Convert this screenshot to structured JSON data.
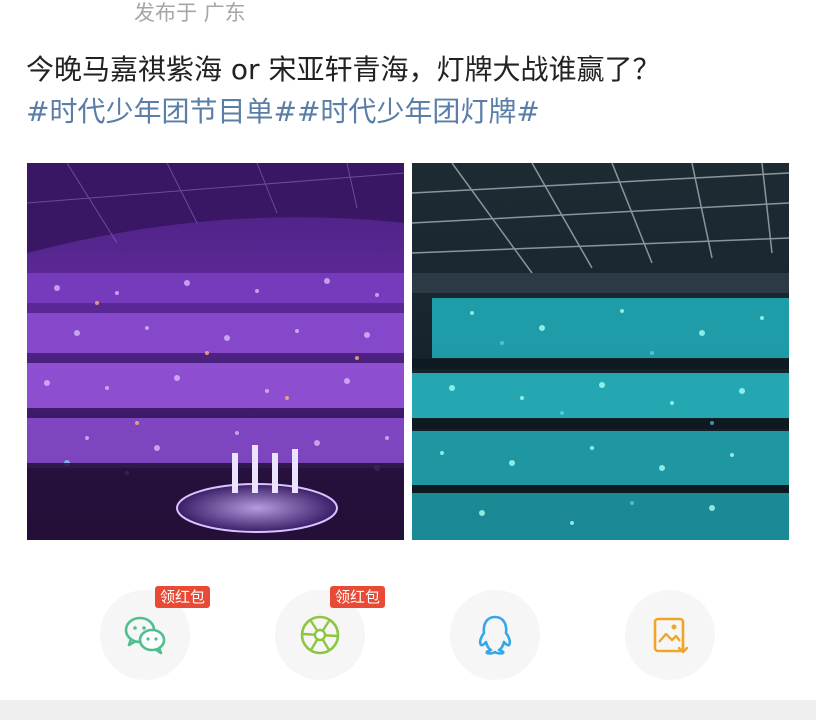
{
  "post": {
    "location": "发布于 广东",
    "title": "今晚马嘉祺紫海 or 宋亚轩青海，灯牌大战谁赢了？",
    "hashtags": [
      "#时代少年团节目单#",
      "#时代少年团灯牌#"
    ]
  },
  "images": [
    {
      "desc_name": "purple-light-sea-photo"
    },
    {
      "desc_name": "blue-light-sea-photo"
    }
  ],
  "share": {
    "items": [
      {
        "name": "wechat",
        "icon": "wechat-icon",
        "badge": "领红包"
      },
      {
        "name": "moments",
        "icon": "moments-shutter-icon",
        "badge": "领红包"
      },
      {
        "name": "qq",
        "icon": "qq-penguin-icon",
        "badge": ""
      },
      {
        "name": "save-image",
        "icon": "save-image-icon",
        "badge": ""
      }
    ]
  },
  "colors": {
    "hashtag": "#5a7ea8",
    "badge": "#e94a35",
    "wechat": "#4fc08d",
    "moments": "#8cc63f",
    "qq": "#35a7e8",
    "save": "#f0a42a"
  }
}
